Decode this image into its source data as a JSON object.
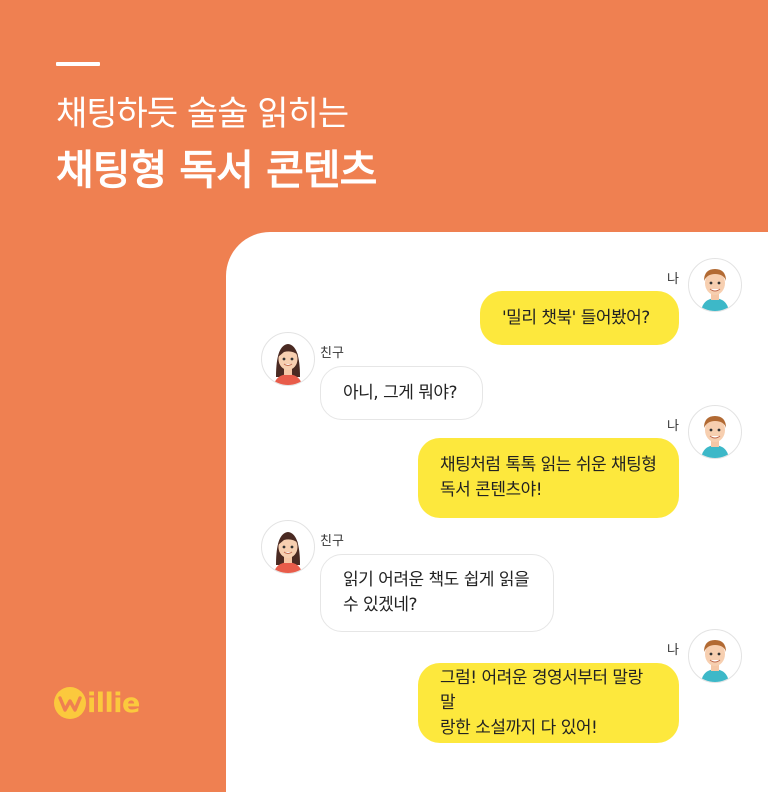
{
  "header": {
    "subtitle": "채팅하듯 술술 읽히는",
    "title": "채팅형 독서 콘텐츠"
  },
  "brand": {
    "logo_text": "illie",
    "logo_color": "#FBC93D",
    "background_color": "#EF8051"
  },
  "chat": {
    "messages": [
      {
        "sender": "나",
        "avatar": "boy-avatar-icon",
        "text": "'밀리 챗북' 들어봤어?"
      },
      {
        "sender": "친구",
        "avatar": "girl-avatar-icon",
        "text": "아니, 그게 뭐야?"
      },
      {
        "sender": "나",
        "avatar": "boy-avatar-icon",
        "text": "채팅처럼 톡톡 읽는 쉬운 채팅형\n독서 콘텐츠야!"
      },
      {
        "sender": "친구",
        "avatar": "girl-avatar-icon",
        "text": "읽기 어려운 책도 쉽게 읽을\n수 있겠네?"
      },
      {
        "sender": "나",
        "avatar": "boy-avatar-icon",
        "text": "그럼! 어려운 경영서부터 말랑말\n랑한 소설까지 다 있어!"
      }
    ],
    "colors": {
      "me_bubble": "#FDE83D",
      "friend_bubble": "#FFFFFF"
    }
  }
}
